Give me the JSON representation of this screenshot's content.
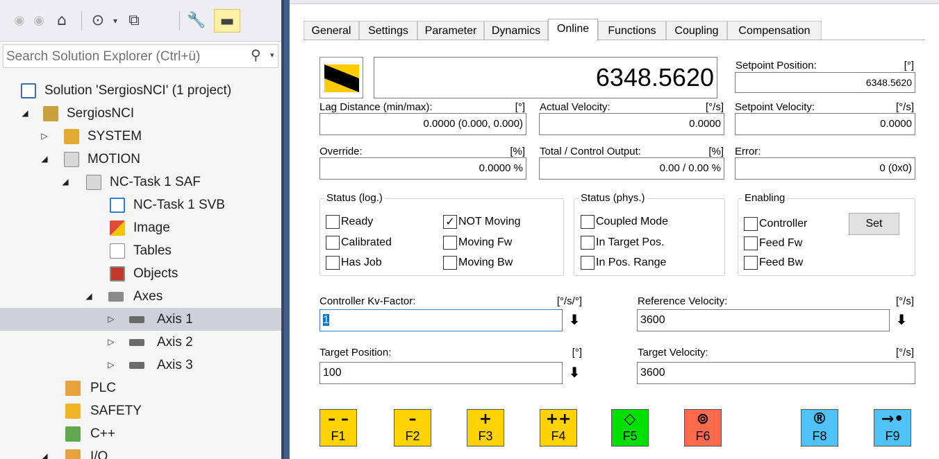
{
  "explorer": {
    "search_placeholder": "Search Solution Explorer (Ctrl+ü)",
    "tree": [
      {
        "label": "Solution 'SergiosNCI' (1 project)",
        "icon": "solution-icon"
      },
      {
        "label": "SergiosNCI",
        "icon": "project-icon"
      },
      {
        "label": "SYSTEM",
        "icon": "system-icon"
      },
      {
        "label": "MOTION",
        "icon": "motion-icon"
      },
      {
        "label": "NC-Task 1 SAF",
        "icon": "nc-task-icon"
      },
      {
        "label": "NC-Task 1 SVB",
        "icon": "svb-icon"
      },
      {
        "label": "Image",
        "icon": "image-icon"
      },
      {
        "label": "Tables",
        "icon": "tables-icon"
      },
      {
        "label": "Objects",
        "icon": "objects-icon"
      },
      {
        "label": "Axes",
        "icon": "axes-icon"
      },
      {
        "label": "Axis 1",
        "icon": "axis-icon"
      },
      {
        "label": "Axis 2",
        "icon": "axis-icon"
      },
      {
        "label": "Axis 3",
        "icon": "axis-icon"
      },
      {
        "label": "PLC",
        "icon": "plc-icon"
      },
      {
        "label": "SAFETY",
        "icon": "safety-icon"
      },
      {
        "label": "C++",
        "icon": "cpp-icon"
      },
      {
        "label": "I/O",
        "icon": "io-icon"
      }
    ]
  },
  "tabs": [
    "General",
    "Settings",
    "Parameter",
    "Dynamics",
    "Online",
    "Functions",
    "Coupling",
    "Compensation"
  ],
  "active_tab": "Online",
  "online": {
    "actual_position": "6348.5620",
    "setpoint_position": {
      "label": "Setpoint Position:",
      "unit": "[°]",
      "value": "6348.5620"
    },
    "lag_distance": {
      "label": "Lag Distance (min/max):",
      "unit": "[°]",
      "value": "0.0000  (0.000, 0.000)"
    },
    "actual_velocity": {
      "label": "Actual Velocity:",
      "unit": "[°/s]",
      "value": "0.0000"
    },
    "setpoint_velocity": {
      "label": "Setpoint Velocity:",
      "unit": "[°/s]",
      "value": "0.0000"
    },
    "override": {
      "label": "Override:",
      "unit": "[%]",
      "value": "0.0000 %"
    },
    "control_output": {
      "label": "Total / Control Output:",
      "unit": "[%]",
      "value": "0.00 /  0.00 %"
    },
    "error": {
      "label": "Error:",
      "value": "0 (0x0)"
    }
  },
  "status_log": {
    "title": "Status (log.)",
    "items": [
      {
        "label": "Ready",
        "checked": false
      },
      {
        "label": "Calibrated",
        "checked": false
      },
      {
        "label": "Has Job",
        "checked": false
      },
      {
        "label": "NOT Moving",
        "checked": true
      },
      {
        "label": "Moving Fw",
        "checked": false
      },
      {
        "label": "Moving Bw",
        "checked": false
      }
    ]
  },
  "status_phys": {
    "title": "Status (phys.)",
    "items": [
      {
        "label": "Coupled Mode",
        "checked": false
      },
      {
        "label": "In Target Pos.",
        "checked": false
      },
      {
        "label": "In Pos. Range",
        "checked": false
      }
    ]
  },
  "enabling": {
    "title": "Enabling",
    "items": [
      {
        "label": "Controller",
        "checked": false
      },
      {
        "label": "Feed Fw",
        "checked": false
      },
      {
        "label": "Feed Bw",
        "checked": false
      }
    ],
    "set_label": "Set"
  },
  "inputs": {
    "kv_factor": {
      "label": "Controller Kv-Factor:",
      "unit": "[°/s/°]",
      "value": "1"
    },
    "reference_velocity": {
      "label": "Reference Velocity:",
      "unit": "[°/s]",
      "value": "3600"
    },
    "target_position": {
      "label": "Target Position:",
      "unit": "[°]",
      "value": "100"
    },
    "target_velocity": {
      "label": "Target Velocity:",
      "unit": "[°/s]",
      "value": "3600"
    }
  },
  "fkeys": [
    {
      "name": "F1",
      "symbol": "– –",
      "color": "#ffd200"
    },
    {
      "name": "F2",
      "symbol": "–",
      "color": "#ffd200"
    },
    {
      "name": "F3",
      "symbol": "+",
      "color": "#ffd200"
    },
    {
      "name": "F4",
      "symbol": "++",
      "color": "#ffd200"
    },
    {
      "name": "F5",
      "symbol": "◇",
      "color": "#00e000"
    },
    {
      "name": "F6",
      "symbol": "⊚",
      "color": "#ff6a4d"
    },
    {
      "name": "F8",
      "symbol": "®",
      "color": "#4fc3f7"
    },
    {
      "name": "F9",
      "symbol": "→•",
      "color": "#4fc3f7"
    }
  ]
}
